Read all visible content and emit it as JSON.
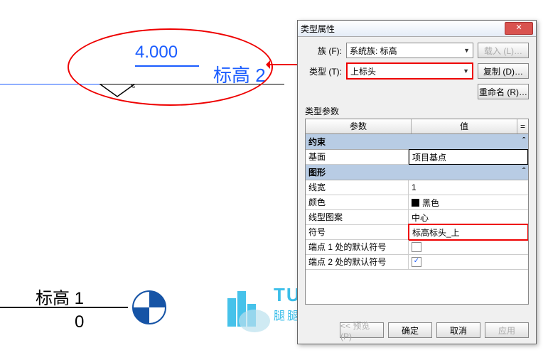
{
  "drawing": {
    "level2_value": "4.000",
    "level2_label": "标高 2",
    "level1_label": "标高 1",
    "level1_value": "0"
  },
  "watermark": {
    "big": "TUITUISOFT",
    "small": "腿腿教学网"
  },
  "dialog": {
    "title": "类型属性",
    "family_label": "族 (F):",
    "family_value": "系统族: 标高",
    "type_label": "类型 (T):",
    "type_value": "上标头",
    "load_btn": "载入 (L)…",
    "dup_btn": "复制 (D)…",
    "rename_btn": "重命名 (R)…",
    "params_label": "类型参数",
    "col_param": "参数",
    "col_value": "值",
    "sect_constraint": "约束",
    "row_base": "基面",
    "row_base_val": "项目基点",
    "sect_graphics": "图形",
    "row_lw": "线宽",
    "row_lw_val": "1",
    "row_color": "颜色",
    "row_color_val": "黑色",
    "row_pattern": "线型图案",
    "row_pattern_val": "中心",
    "row_symbol": "符号",
    "row_symbol_val": "标高标头_上",
    "row_end1": "端点 1 处的默认符号",
    "row_end2": "端点 2 处的默认符号",
    "preview_btn": "<< 预览 (P)",
    "ok_btn": "确定",
    "cancel_btn": "取消",
    "apply_btn": "应用"
  }
}
